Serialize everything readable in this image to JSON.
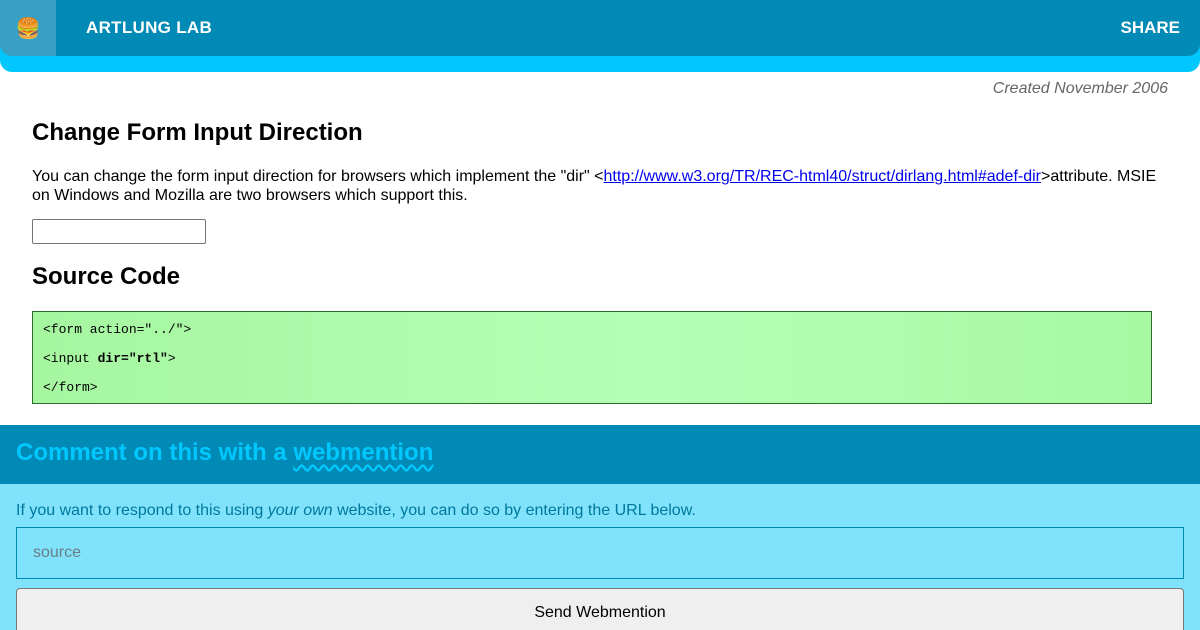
{
  "header": {
    "logo_icon": "🍔",
    "site_title": "ARTLUNG LAB",
    "share_label": "SHARE",
    "colors": {
      "bar": "#008ab5",
      "accent": "#00c8ff"
    }
  },
  "article": {
    "created": "Created November 2006",
    "title": "Change Form Input Direction",
    "intro_before": "You can change the form input direction for browsers which implement the \"dir\" <",
    "intro_link": "http://www.w3.org/TR/REC-html40/struct/dirlang.html#adef-dir",
    "intro_after": ">attribute. MSIE on Windows and Mozilla are two browsers which support this.",
    "demo_input_value": "",
    "source_heading": "Source Code",
    "code": {
      "line1": "<form action=\"../\">",
      "line2_start": "<input ",
      "line2_bold": "dir=\"rtl\"",
      "line2_end": ">",
      "line3": "</form>"
    }
  },
  "webmention": {
    "title_prefix": "Comment on this with a ",
    "title_link": "webmention",
    "text_before": "If you want to respond to this using ",
    "text_em": "your own",
    "text_after": " website, you can do so by entering the URL below.",
    "input_placeholder": "source",
    "input_value": "",
    "button_label": "Send Webmention"
  }
}
